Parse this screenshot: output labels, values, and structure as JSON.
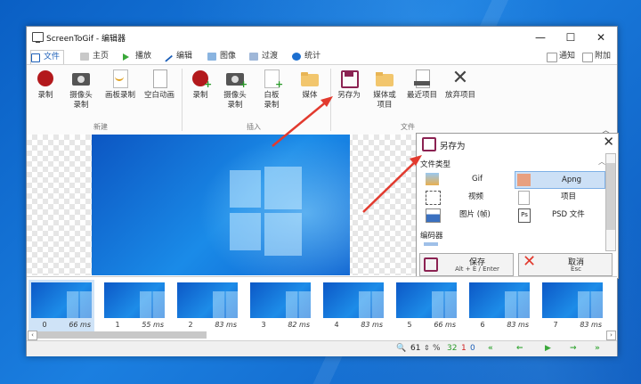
{
  "window": {
    "title": "ScreenToGif - 编辑器",
    "minimize": "—",
    "maximize": "☐",
    "close": "✕"
  },
  "tabs": [
    {
      "label": "文件",
      "active": true
    },
    {
      "label": "主页"
    },
    {
      "label": "播放"
    },
    {
      "label": "编辑"
    },
    {
      "label": "图像"
    },
    {
      "label": "过渡"
    },
    {
      "label": "统计"
    }
  ],
  "tabs_right": {
    "notify": "通知",
    "extra": "附加"
  },
  "ribbon": {
    "new_group": {
      "label": "新建",
      "items": [
        {
          "line1": "录制",
          "line2": "",
          "icon": "record-icon"
        },
        {
          "line1": "摄像头",
          "line2": "录制",
          "icon": "camera-icon"
        },
        {
          "line1": "画板录制",
          "line2": "",
          "icon": "board-icon"
        },
        {
          "line1": "空白动画",
          "line2": "",
          "icon": "blank-file-icon"
        }
      ]
    },
    "insert_group": {
      "label": "插入",
      "items": [
        {
          "line1": "录制",
          "line2": "",
          "icon": "record-add-icon"
        },
        {
          "line1": "摄像头",
          "line2": "录制",
          "icon": "camera-add-icon"
        },
        {
          "line1": "白板",
          "line2": "录制",
          "icon": "board-add-icon"
        },
        {
          "line1": "媒体",
          "line2": "",
          "icon": "folder-icon"
        }
      ]
    },
    "file_group": {
      "label": "文件",
      "items": [
        {
          "line1": "另存为",
          "line2": "",
          "icon": "save-icon"
        },
        {
          "line1": "媒体或",
          "line2": "项目",
          "icon": "open-folder-icon"
        },
        {
          "line1": "最近项目",
          "line2": "",
          "icon": "recent-icon"
        },
        {
          "line1": "放弃项目",
          "line2": "",
          "icon": "discard-icon"
        }
      ]
    }
  },
  "save_panel": {
    "title": "另存为",
    "file_type_label": "文件类型",
    "file_types": [
      {
        "label": "Gif",
        "icon": "gif-icon"
      },
      {
        "label": "Apng",
        "icon": "apng-icon",
        "selected": true
      },
      {
        "label": "视频",
        "icon": "video-icon"
      },
      {
        "label": "项目",
        "icon": "project-icon"
      },
      {
        "label": "图片 (帧)",
        "icon": "image-icon"
      },
      {
        "label": "PSD 文件",
        "icon": "psd-icon"
      }
    ],
    "encoder_label": "编码器",
    "save_button": {
      "label": "保存",
      "shortcut": "Alt + E / Enter"
    },
    "cancel_button": {
      "label": "取消",
      "shortcut": "Esc"
    }
  },
  "frames": [
    {
      "index": "0",
      "delay": "66 ms"
    },
    {
      "index": "1",
      "delay": "55 ms"
    },
    {
      "index": "2",
      "delay": "83 ms"
    },
    {
      "index": "3",
      "delay": "82 ms"
    },
    {
      "index": "4",
      "delay": "83 ms"
    },
    {
      "index": "5",
      "delay": "66 ms"
    },
    {
      "index": "6",
      "delay": "83 ms"
    },
    {
      "index": "7",
      "delay": "83 ms"
    }
  ],
  "status": {
    "zoom": "61",
    "zoom_unit": "%",
    "frame_count": "32",
    "selected_count": "1",
    "extra_count": "0"
  },
  "colors": {
    "accent": "#1c5fb8",
    "count_green": "#2a9a2a",
    "count_red": "#d02020",
    "nav_green": "#3aa83a",
    "arrow_red": "#e23a2e"
  }
}
